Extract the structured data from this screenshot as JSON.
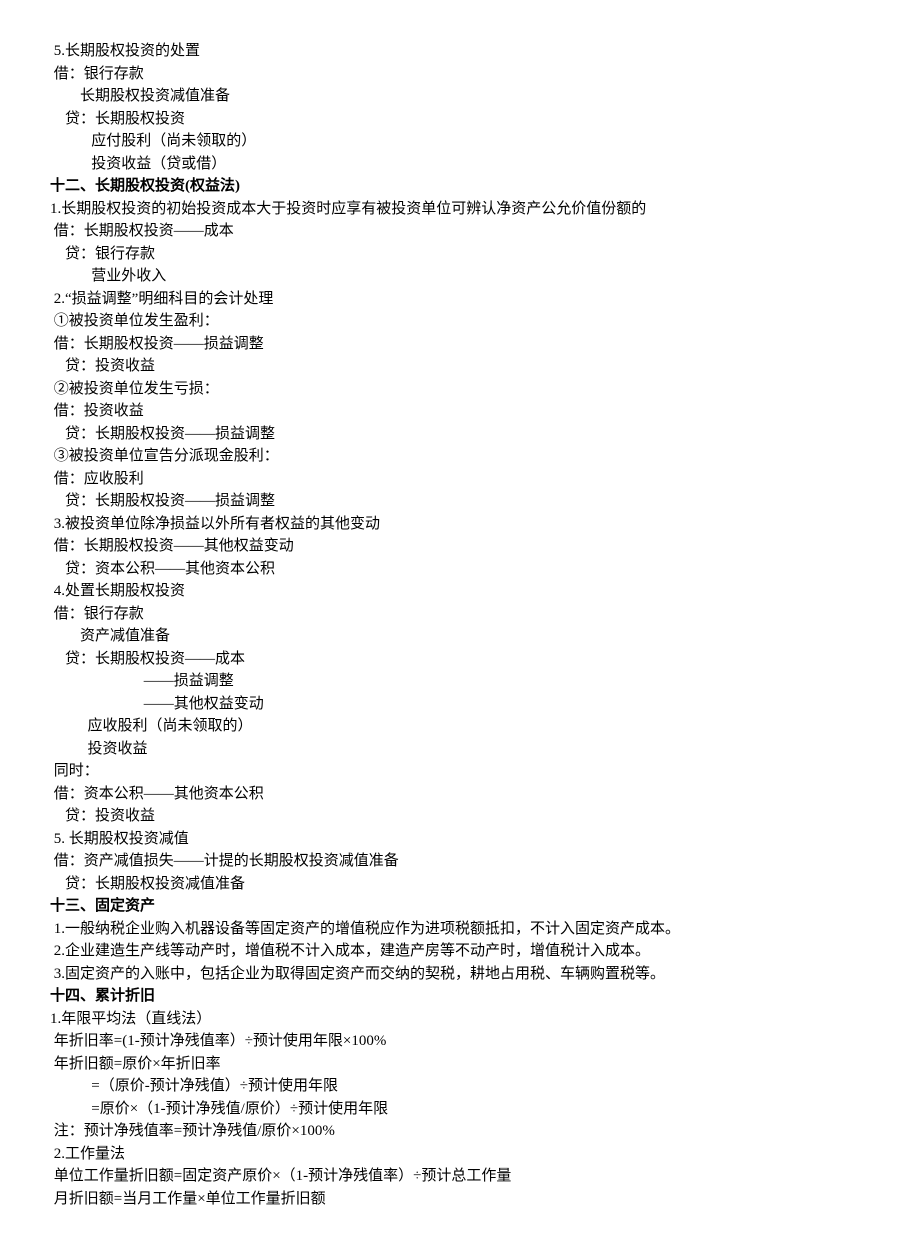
{
  "lines": [
    {
      "text": " 5.长期股权投资的处置",
      "bold": false
    },
    {
      "text": " 借：银行存款",
      "bold": false
    },
    {
      "text": "        长期股权投资减值准备",
      "bold": false
    },
    {
      "text": "    贷：长期股权投资",
      "bold": false
    },
    {
      "text": "           应付股利（尚未领取的）",
      "bold": false
    },
    {
      "text": "           投资收益（贷或借）",
      "bold": false
    },
    {
      "text": "十二、长期股权投资(权益法)",
      "bold": true
    },
    {
      "text": "1.长期股权投资的初始投资成本大于投资时应享有被投资单位可辨认净资产公允价值份额的",
      "bold": false
    },
    {
      "text": " 借：长期股权投资——成本",
      "bold": false
    },
    {
      "text": "    贷：银行存款",
      "bold": false
    },
    {
      "text": "           营业外收入",
      "bold": false
    },
    {
      "text": " 2.“损益调整”明细科目的会计处理",
      "bold": false
    },
    {
      "text": " ①被投资单位发生盈利：",
      "bold": false
    },
    {
      "text": " 借：长期股权投资——损益调整",
      "bold": false
    },
    {
      "text": "    贷：投资收益",
      "bold": false
    },
    {
      "text": " ②被投资单位发生亏损：",
      "bold": false
    },
    {
      "text": " 借：投资收益",
      "bold": false
    },
    {
      "text": "    贷：长期股权投资——损益调整",
      "bold": false
    },
    {
      "text": " ③被投资单位宣告分派现金股利：",
      "bold": false
    },
    {
      "text": " 借：应收股利",
      "bold": false
    },
    {
      "text": "    贷：长期股权投资——损益调整",
      "bold": false
    },
    {
      "text": " 3.被投资单位除净损益以外所有者权益的其他变动",
      "bold": false
    },
    {
      "text": " 借：长期股权投资——其他权益变动",
      "bold": false
    },
    {
      "text": "    贷：资本公积——其他资本公积",
      "bold": false
    },
    {
      "text": " 4.处置长期股权投资",
      "bold": false
    },
    {
      "text": " 借：银行存款",
      "bold": false
    },
    {
      "text": "        资产减值准备",
      "bold": false
    },
    {
      "text": "    贷：长期股权投资——成本",
      "bold": false
    },
    {
      "text": "                         ——损益调整",
      "bold": false
    },
    {
      "text": "                         ——其他权益变动",
      "bold": false
    },
    {
      "text": "          应收股利（尚未领取的）",
      "bold": false
    },
    {
      "text": "          投资收益",
      "bold": false
    },
    {
      "text": " 同时：",
      "bold": false
    },
    {
      "text": " 借：资本公积——其他资本公积",
      "bold": false
    },
    {
      "text": "    贷：投资收益",
      "bold": false
    },
    {
      "text": " 5. 长期股权投资减值",
      "bold": false
    },
    {
      "text": " 借：资产减值损失——计提的长期股权投资减值准备",
      "bold": false
    },
    {
      "text": "    贷：长期股权投资减值准备",
      "bold": false
    },
    {
      "text": "十三、固定资产",
      "bold": true
    },
    {
      "text": " 1.一般纳税企业购入机器设备等固定资产的增值税应作为进项税额抵扣，不计入固定资产成本。",
      "bold": false
    },
    {
      "text": " 2.企业建造生产线等动产时，增值税不计入成本，建造产房等不动产时，增值税计入成本。",
      "bold": false
    },
    {
      "text": " 3.固定资产的入账中，包括企业为取得固定资产而交纳的契税，耕地占用税、车辆购置税等。",
      "bold": false
    },
    {
      "text": "十四、累计折旧",
      "bold": true
    },
    {
      "text": "1.年限平均法（直线法）",
      "bold": false
    },
    {
      "text": " 年折旧率=(1-预计净残值率）÷预计使用年限×100%",
      "bold": false
    },
    {
      "text": " 年折旧额=原价×年折旧率",
      "bold": false
    },
    {
      "text": "           =（原价-预计净残值）÷预计使用年限",
      "bold": false
    },
    {
      "text": "           =原价×（1-预计净残值/原价）÷预计使用年限",
      "bold": false
    },
    {
      "text": " 注：预计净残值率=预计净残值/原价×100%",
      "bold": false
    },
    {
      "text": " 2.工作量法",
      "bold": false
    },
    {
      "text": " 单位工作量折旧额=固定资产原价×（1-预计净残值率）÷预计总工作量",
      "bold": false
    },
    {
      "text": " 月折旧额=当月工作量×单位工作量折旧额",
      "bold": false
    }
  ]
}
